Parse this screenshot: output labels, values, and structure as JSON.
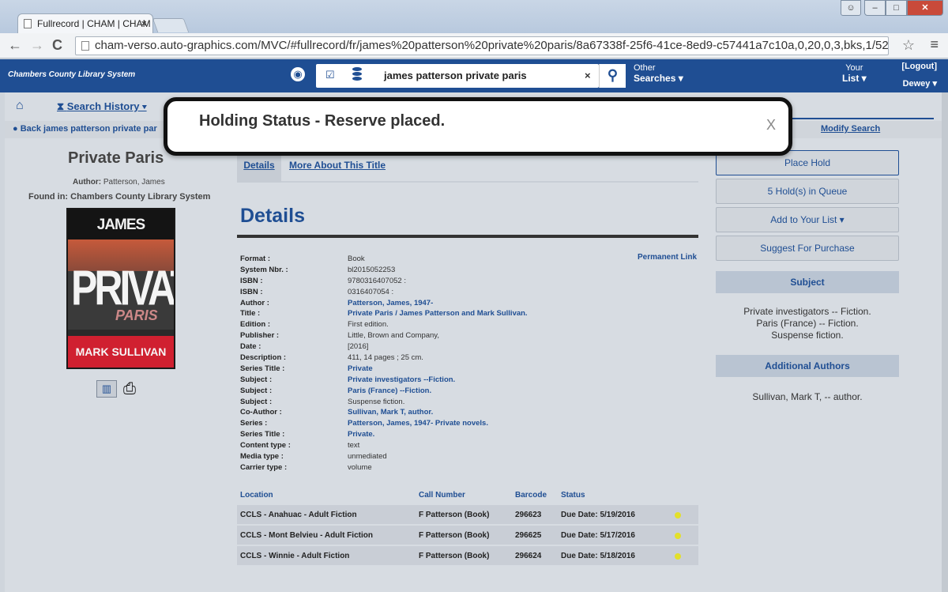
{
  "browser": {
    "tab_title": "Fullrecord | CHAM | CHAM",
    "tab_close": "×",
    "url": "cham-verso.auto-graphics.com/MVC/#fullrecord/fr/james%20patterson%20private%20paris/8a67338f-25f6-41ce-8ed9-c57441a7c10a,0,20,0,3,bks,1/52/0",
    "nav_back": "←",
    "nav_forward": "→",
    "nav_reload": "C",
    "star": "☆",
    "menu": "≡",
    "win_user": "☺",
    "win_min": "–",
    "win_max": "□",
    "win_close": "✕"
  },
  "header": {
    "site_name": "Chambers County Library System",
    "search_query": "james patterson private paris",
    "clear": "×",
    "search_button": "🔍",
    "other": "Other",
    "searches": "Searches ▾",
    "your": "Your",
    "list": "List ▾",
    "logout": "[Logout]",
    "dewey": "Dewey ▾"
  },
  "subnav": {
    "search_history": "Search History ▾",
    "back_link": "Back james patterson private par",
    "modify_search": "Modify Search"
  },
  "record": {
    "title": "Private Paris",
    "author_label": "Author:",
    "author_value": "Patterson, James",
    "found_in": "Found in: Chambers County Library System",
    "cover": {
      "top": "JAMES PATTERSON",
      "big": "PRIVATE",
      "sub": "PARIS",
      "bottom": "MARK SULLIVAN"
    }
  },
  "tabs": {
    "details": "Details",
    "more": "More About This Title"
  },
  "details": {
    "heading": "Details",
    "permanent_link": "Permanent Link",
    "fields": [
      {
        "label": "Format :",
        "value": "Book",
        "link": false
      },
      {
        "label": "System Nbr. :",
        "value": "bl2015052253",
        "link": false
      },
      {
        "label": "ISBN :",
        "value": "9780316407052 :",
        "link": false
      },
      {
        "label": "ISBN :",
        "value": "0316407054 :",
        "link": false
      },
      {
        "label": "Author :",
        "value": "Patterson, James, 1947-",
        "link": true
      },
      {
        "label": "Title :",
        "value": "Private Paris / James Patterson and Mark Sullivan.",
        "link": true
      },
      {
        "label": "Edition :",
        "value": "First edition.",
        "link": false
      },
      {
        "label": "Publisher :",
        "value": "Little, Brown and Company,",
        "link": false
      },
      {
        "label": "Date :",
        "value": "[2016]",
        "link": false
      },
      {
        "label": "Description :",
        "value": "411, 14 pages ; 25 cm.",
        "link": false
      },
      {
        "label": "Series Title :",
        "value": "Private",
        "link": true
      },
      {
        "label": "Subject :",
        "value": "Private investigators --Fiction.",
        "link": true
      },
      {
        "label": "Subject :",
        "value": "Paris (France) --Fiction.",
        "link": true
      },
      {
        "label": "Subject :",
        "value": "Suspense fiction.",
        "link": false
      },
      {
        "label": "Co-Author :",
        "value": "Sullivan, Mark T, author.",
        "link": true
      },
      {
        "label": "Series :",
        "value": "Patterson, James, 1947- Private novels.",
        "link": true
      },
      {
        "label": "Series Title :",
        "value": "Private.",
        "link": true
      },
      {
        "label": "Content type :",
        "value": "text",
        "link": false
      },
      {
        "label": "Media type :",
        "value": "unmediated",
        "link": false
      },
      {
        "label": "Carrier type :",
        "value": "volume",
        "link": false
      }
    ]
  },
  "holdings": {
    "headers": {
      "location": "Location",
      "call_number": "Call Number",
      "barcode": "Barcode",
      "status": "Status"
    },
    "rows": [
      {
        "location": "CCLS - Anahuac - Adult Fiction",
        "call_number": "F Patterson (Book)",
        "barcode": "296623",
        "status": "Due Date: 5/19/2016"
      },
      {
        "location": "CCLS - Mont Belvieu - Adult Fiction",
        "call_number": "F Patterson (Book)",
        "barcode": "296625",
        "status": "Due Date: 5/17/2016"
      },
      {
        "location": "CCLS - Winnie - Adult Fiction",
        "call_number": "F Patterson (Book)",
        "barcode": "296624",
        "status": "Due Date: 5/18/2016"
      }
    ],
    "status_color": "#e3e02a"
  },
  "sidebar": {
    "place_hold": "Place Hold",
    "holds_queue": "5 Hold(s) in Queue",
    "add_list": "Add to Your List ▾",
    "suggest": "Suggest For Purchase",
    "subject_head": "Subject",
    "subjects": [
      "Private investigators -- Fiction.",
      "Paris (France) -- Fiction.",
      "Suspense fiction."
    ],
    "authors_head": "Additional Authors",
    "authors": [
      "Sullivan, Mark T, -- author."
    ]
  },
  "toast": {
    "message": "Holding Status - Reserve placed.",
    "close": "X"
  },
  "colors": {
    "brand": "#1f4e93",
    "background": "#d7dce2"
  }
}
